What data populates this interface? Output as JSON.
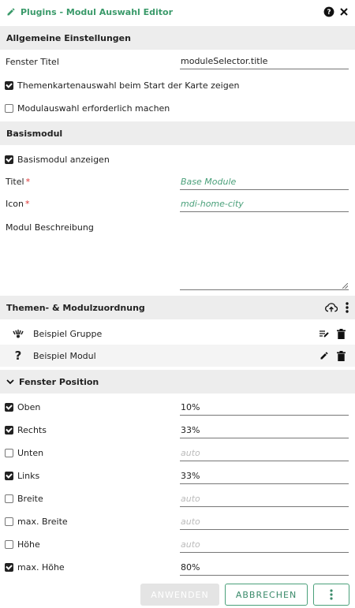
{
  "window": {
    "title": "Plugins - Modul Auswahl Editor",
    "help_icon": "help-circle-icon",
    "close_icon": "close-icon"
  },
  "general": {
    "heading": "Allgemeine Einstellungen",
    "window_title_label": "Fenster Titel",
    "window_title_value": "moduleSelector.title",
    "theme_map_checkbox": {
      "label": "Themenkartenauswahl beim Start der Karte zeigen",
      "checked": true
    },
    "module_required_checkbox": {
      "label": "Modulauswahl erforderlich machen",
      "checked": false
    }
  },
  "base_module": {
    "heading": "Basismodul",
    "show_checkbox": {
      "label": "Basismodul anzeigen",
      "checked": true
    },
    "title_label": "Titel",
    "title_value": "Base Module",
    "icon_label": "Icon",
    "icon_value": "mdi-home-city",
    "required_marker": "*",
    "description_label": "Modul Beschreibung",
    "description_value": ""
  },
  "assignment": {
    "heading": "Themen- & Modulzuordnung",
    "items": [
      {
        "label": "Beispiel Gruppe",
        "icon": "group-icon"
      },
      {
        "label": "Beispiel Modul",
        "icon": "question-icon"
      }
    ]
  },
  "position": {
    "heading": "Fenster Position",
    "rows": [
      {
        "label": "Oben",
        "checked": true,
        "value": "10%",
        "placeholder": "auto"
      },
      {
        "label": "Rechts",
        "checked": true,
        "value": "33%",
        "placeholder": "auto"
      },
      {
        "label": "Unten",
        "checked": false,
        "value": "",
        "placeholder": "auto"
      },
      {
        "label": "Links",
        "checked": true,
        "value": "33%",
        "placeholder": "auto"
      },
      {
        "label": "Breite",
        "checked": false,
        "value": "",
        "placeholder": "auto"
      },
      {
        "label": "max. Breite",
        "checked": false,
        "value": "",
        "placeholder": "auto"
      },
      {
        "label": "Höhe",
        "checked": false,
        "value": "",
        "placeholder": "auto"
      },
      {
        "label": "max. Höhe",
        "checked": true,
        "value": "80%",
        "placeholder": "auto"
      }
    ]
  },
  "footer": {
    "apply_label": "ANWENDEN",
    "cancel_label": "ABBRECHEN"
  },
  "colors": {
    "accent": "#3a9a6a",
    "section_bg": "#ededed",
    "required": "#dd3333"
  }
}
